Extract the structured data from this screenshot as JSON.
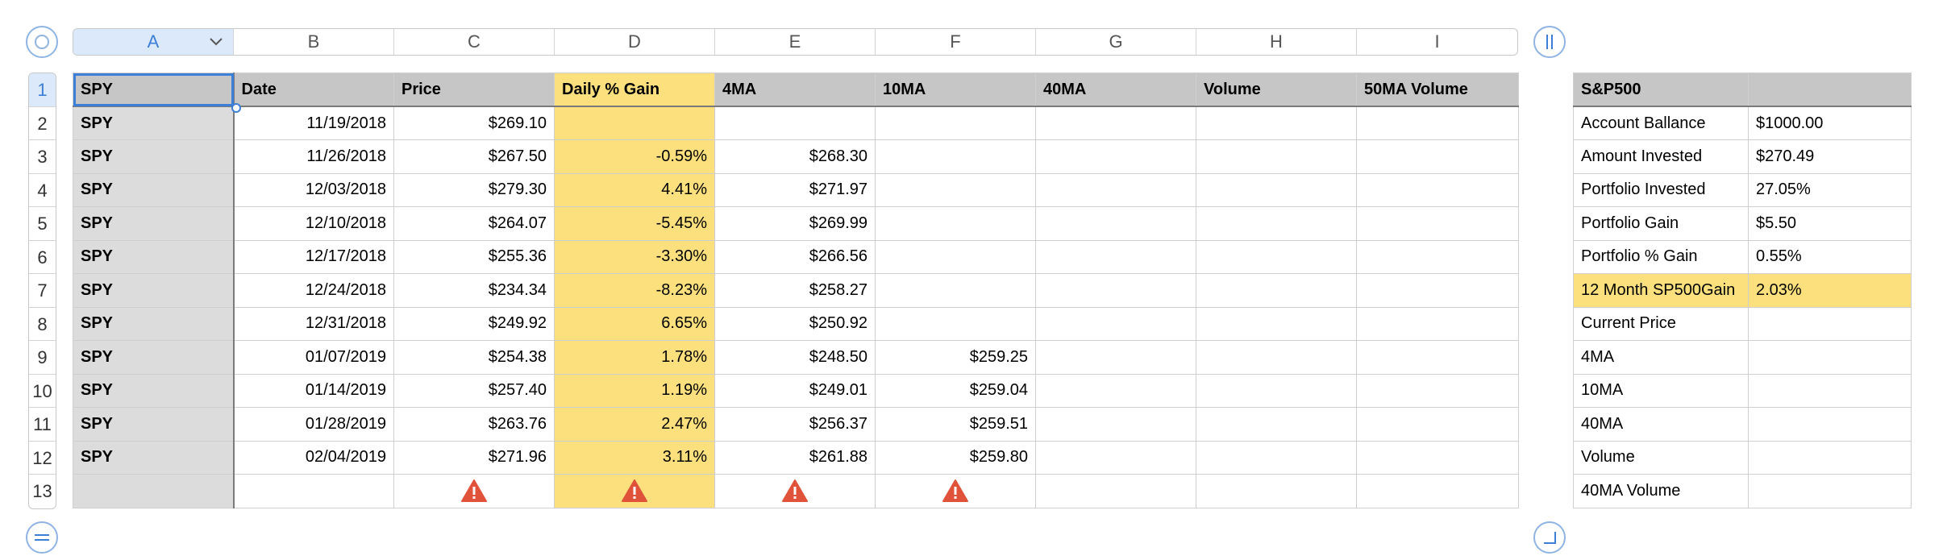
{
  "column_headers": [
    "A",
    "B",
    "C",
    "D",
    "E",
    "F",
    "G",
    "H",
    "I"
  ],
  "row_headers": [
    "1",
    "2",
    "3",
    "4",
    "5",
    "6",
    "7",
    "8",
    "9",
    "10",
    "11",
    "12",
    "13"
  ],
  "main_table": {
    "header": [
      "SPY",
      "Date",
      "Price",
      "Daily % Gain",
      "4MA",
      "10MA",
      "40MA",
      "Volume",
      "50MA Volume"
    ],
    "rows": [
      [
        "SPY",
        "11/19/2018",
        "$269.10",
        "",
        "",
        "",
        "",
        "",
        ""
      ],
      [
        "SPY",
        "11/26/2018",
        "$267.50",
        "-0.59%",
        "$268.30",
        "",
        "",
        "",
        ""
      ],
      [
        "SPY",
        "12/03/2018",
        "$279.30",
        "4.41%",
        "$271.97",
        "",
        "",
        "",
        ""
      ],
      [
        "SPY",
        "12/10/2018",
        "$264.07",
        "-5.45%",
        "$269.99",
        "",
        "",
        "",
        ""
      ],
      [
        "SPY",
        "12/17/2018",
        "$255.36",
        "-3.30%",
        "$266.56",
        "",
        "",
        "",
        ""
      ],
      [
        "SPY",
        "12/24/2018",
        "$234.34",
        "-8.23%",
        "$258.27",
        "",
        "",
        "",
        ""
      ],
      [
        "SPY",
        "12/31/2018",
        "$249.92",
        "6.65%",
        "$250.92",
        "",
        "",
        "",
        ""
      ],
      [
        "SPY",
        "01/07/2019",
        "$254.38",
        "1.78%",
        "$248.50",
        "$259.25",
        "",
        "",
        ""
      ],
      [
        "SPY",
        "01/14/2019",
        "$257.40",
        "1.19%",
        "$249.01",
        "$259.04",
        "",
        "",
        ""
      ],
      [
        "SPY",
        "01/28/2019",
        "$263.76",
        "2.47%",
        "$256.37",
        "$259.51",
        "",
        "",
        ""
      ],
      [
        "SPY",
        "02/04/2019",
        "$271.96",
        "3.11%",
        "$261.88",
        "$259.80",
        "",
        "",
        ""
      ]
    ],
    "warning_columns": [
      "C",
      "D",
      "E",
      "F"
    ]
  },
  "side_table": {
    "header": [
      "S&P500",
      ""
    ],
    "rows": [
      [
        "Account Ballance",
        "$1000.00"
      ],
      [
        "Amount Invested",
        "$270.49"
      ],
      [
        "Portfolio Invested",
        "27.05%"
      ],
      [
        "Portfolio Gain",
        "$5.50"
      ],
      [
        "Portfolio % Gain",
        "0.55%"
      ],
      [
        "12 Month SP500Gain",
        "2.03%"
      ],
      [
        "Current Price",
        ""
      ],
      [
        "4MA",
        ""
      ],
      [
        "10MA",
        ""
      ],
      [
        "40MA",
        ""
      ],
      [
        "Volume",
        ""
      ],
      [
        "40MA Volume",
        ""
      ]
    ],
    "highlight_row": "12 Month SP500Gain"
  },
  "colors": {
    "highlight": "#fce07e",
    "header_fill": "#c6c6c6",
    "selection": "#3d7fd6",
    "warning": "#e0533a"
  },
  "icons": {
    "top_left": "select-table-circle-icon",
    "top_right": "add-column-handle-icon",
    "bottom_left": "add-row-handle-icon",
    "bottom_right": "resize-corner-icon",
    "warning": "warning-triangle-icon",
    "column_menu": "chevron-down-icon"
  }
}
